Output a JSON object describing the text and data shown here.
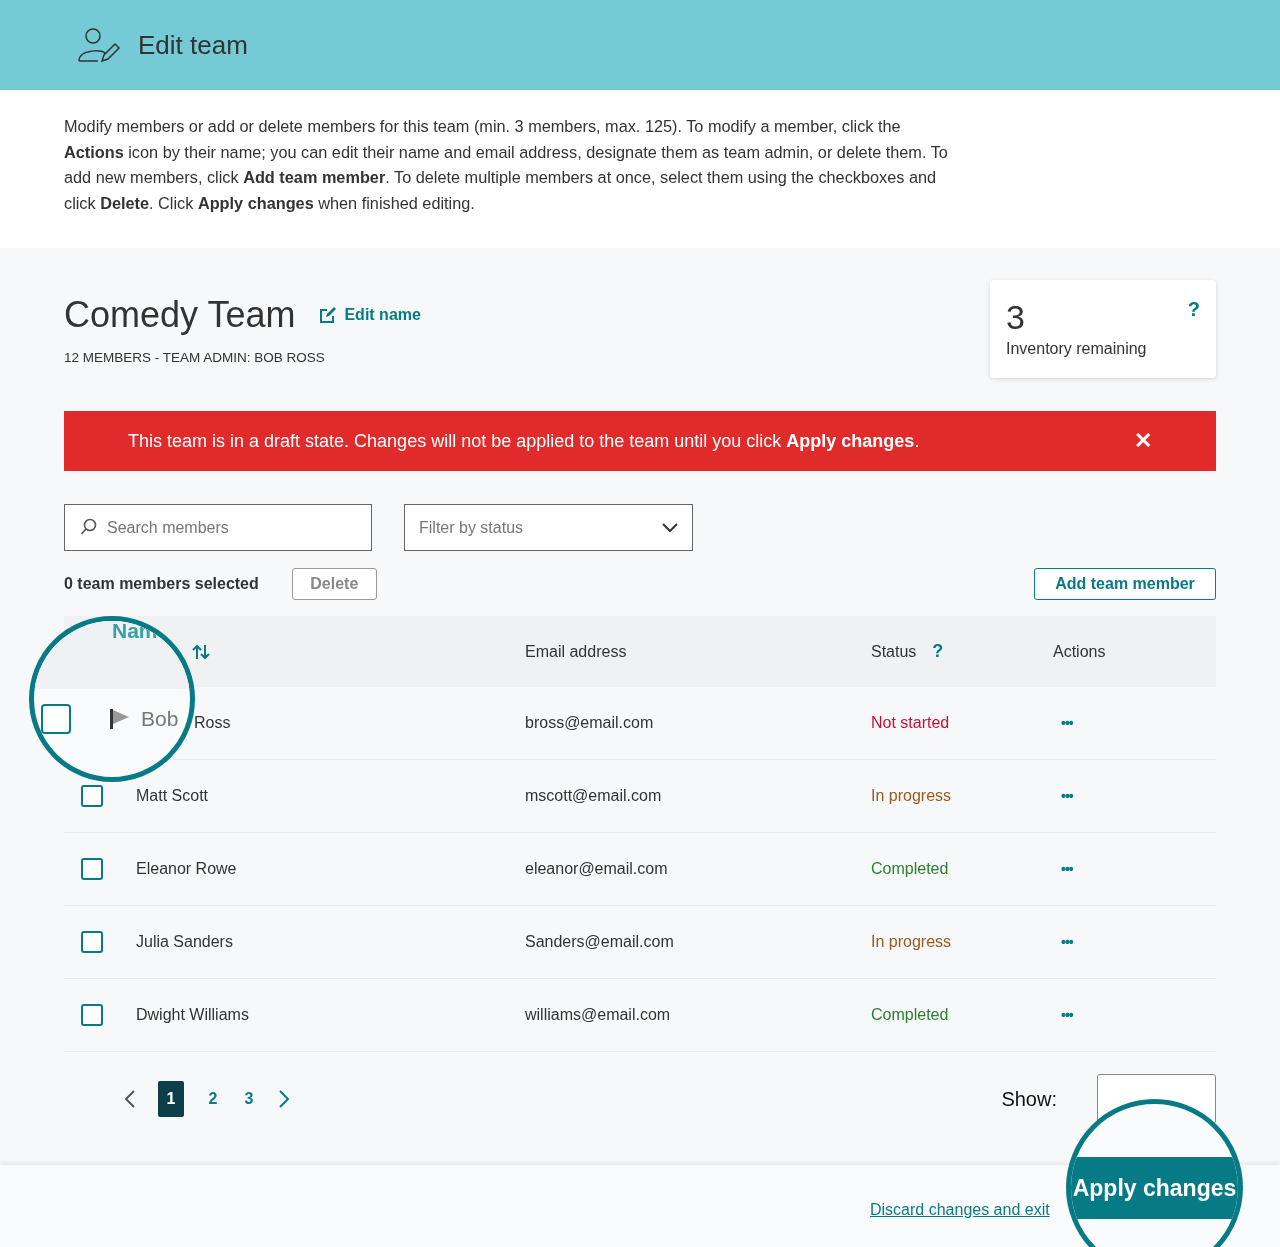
{
  "header": {
    "title": "Edit team"
  },
  "intro": "Modify members or add or delete members for this team (min. 3 members, max. 125). To modify a member, click the **Actions** icon by their name; you can edit their name and email address, designate them as team admin, or delete them. To add new members, click **Add team member**. To delete multiple members at once, select them using the checkboxes and click **Delete**. Click **Apply changes** when finished editing.",
  "team": {
    "name": "Comedy Team",
    "edit_link": "Edit name",
    "subtitle": "12 MEMBERS - TEAM ADMIN: BOB ROSS"
  },
  "inventory": {
    "count": "3",
    "label": "Inventory remaining",
    "help": "?"
  },
  "alert": {
    "text": "This team is in a draft state. Changes will not be applied to the team until you click **Apply changes**.",
    "close": "✕"
  },
  "search": {
    "placeholder": "Search members"
  },
  "filter": {
    "placeholder": "Filter by status"
  },
  "selection": {
    "count_text": "0 team members selected",
    "delete_button": "Delete",
    "delete_disabled": true
  },
  "add_button": "Add team member",
  "table": {
    "columns": [
      {
        "label": "Email address"
      },
      {
        "label": "Status",
        "help": "?"
      },
      {
        "label": "Actions"
      }
    ],
    "rows": [
      {
        "kind": "magnified",
        "name": "Ross",
        "email": "bross@email.com",
        "status": "Not started",
        "color": "#c8102e",
        "actions": "•••"
      },
      {
        "kind": "plain",
        "checked": false,
        "name": "Matt Scott",
        "email": "mscott@email.com",
        "status": "In progress",
        "color": "#9a5a1a",
        "actions": "•••"
      },
      {
        "kind": "plain",
        "checked": false,
        "name": "Eleanor Rowe",
        "email": "eleanor@email.com",
        "status": "Completed",
        "color": "#2e7d32",
        "actions": "•••"
      },
      {
        "kind": "plain",
        "checked": false,
        "name": "Julia Sanders",
        "email": "Sanders@email.com",
        "status": "In progress",
        "color": "#9a5a1a",
        "actions": "•••"
      },
      {
        "kind": "plain",
        "checked": false,
        "name": "Dwight Williams",
        "email": "williams@email.com",
        "status": "Completed",
        "color": "#2e7d32",
        "actions": "•••"
      }
    ]
  },
  "pagination": {
    "pages": [
      {
        "label": "1",
        "selected": true
      },
      {
        "label": "2",
        "selected": false
      },
      {
        "label": "3",
        "selected": false
      }
    ]
  },
  "show": {
    "label": "Show:"
  },
  "magnifier_top": {
    "heading": "Nam",
    "name": "Bob",
    "checked": false
  },
  "footer": {
    "discard_link": "Discard changes and exit",
    "apply_button": "Apply changes"
  }
}
